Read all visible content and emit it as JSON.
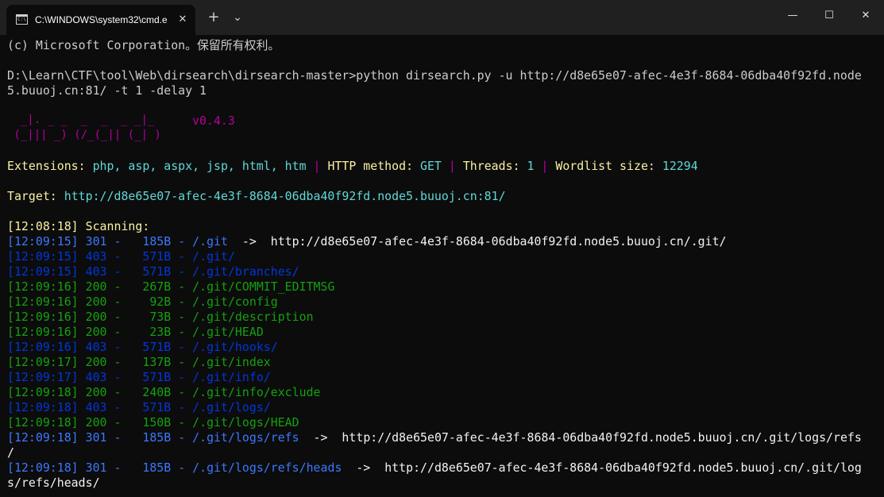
{
  "window": {
    "tab_title": "C:\\WINDOWS\\system32\\cmd.e",
    "tab_close": "✕",
    "new_tab": "+",
    "dropdown": "⌄",
    "minimize": "—",
    "maximize": "☐",
    "close": "✕"
  },
  "terminal": {
    "copyright": "(c) Microsoft Corporation。保留所有权利。",
    "command_line1": "D:\\Learn\\CTF\\tool\\Web\\dirsearch\\dirsearch-master>python dirsearch.py -u http://d8e65e07-afec-4e3f-8684-06dba40f92fd.node",
    "command_line2": "5.buuoj.cn:81/ -t 1 -delay 1",
    "logo_line1": "  _|. _ _  _  _  _ _|_",
    "logo_line2": " (_||| _) (/_(_|| (_| )",
    "version": "v0.4.3",
    "ext_label": "Extensions: ",
    "ext_value": "php, asp, aspx, jsp, html, htm",
    "sep": " | ",
    "method_label": "HTTP method: ",
    "method_value": "GET",
    "threads_label": "Threads: ",
    "threads_value": "1",
    "wordlist_label": "Wordlist size: ",
    "wordlist_value": "12294",
    "target_label": "Target: ",
    "target_value": "http://d8e65e07-afec-4e3f-8684-06dba40f92fd.node5.buuoj.cn:81/",
    "scanning": "[12:08:18] Scanning:",
    "results": [
      {
        "time": "[12:09:15]",
        "status": "301",
        "size": "185B",
        "path": "/.git",
        "redirect": "http://d8e65e07-afec-4e3f-8684-06dba40f92fd.node5.buuoj.cn/.git/",
        "color": "blue"
      },
      {
        "time": "[12:09:15]",
        "status": "403",
        "size": "571B",
        "path": "/.git/",
        "color": "dblue"
      },
      {
        "time": "[12:09:15]",
        "status": "403",
        "size": "571B",
        "path": "/.git/branches/",
        "color": "dblue"
      },
      {
        "time": "[12:09:16]",
        "status": "200",
        "size": "267B",
        "path": "/.git/COMMIT_EDITMSG",
        "color": "green"
      },
      {
        "time": "[12:09:16]",
        "status": "200",
        "size": "92B",
        "path": "/.git/config",
        "color": "green"
      },
      {
        "time": "[12:09:16]",
        "status": "200",
        "size": "73B",
        "path": "/.git/description",
        "color": "green"
      },
      {
        "time": "[12:09:16]",
        "status": "200",
        "size": "23B",
        "path": "/.git/HEAD",
        "color": "green"
      },
      {
        "time": "[12:09:16]",
        "status": "403",
        "size": "571B",
        "path": "/.git/hooks/",
        "color": "dblue"
      },
      {
        "time": "[12:09:17]",
        "status": "200",
        "size": "137B",
        "path": "/.git/index",
        "color": "green"
      },
      {
        "time": "[12:09:17]",
        "status": "403",
        "size": "571B",
        "path": "/.git/info/",
        "color": "dblue"
      },
      {
        "time": "[12:09:18]",
        "status": "200",
        "size": "240B",
        "path": "/.git/info/exclude",
        "color": "green"
      },
      {
        "time": "[12:09:18]",
        "status": "403",
        "size": "571B",
        "path": "/.git/logs/",
        "color": "dblue"
      },
      {
        "time": "[12:09:18]",
        "status": "200",
        "size": "150B",
        "path": "/.git/logs/HEAD",
        "color": "green"
      },
      {
        "time": "[12:09:18]",
        "status": "301",
        "size": "185B",
        "path": "/.git/logs/refs",
        "redirect": "http://d8e65e07-afec-4e3f-8684-06dba40f92fd.node5.buuoj.cn/.git/logs/refs",
        "redirect_cont": "/",
        "color": "blue"
      },
      {
        "time": "[12:09:18]",
        "status": "301",
        "size": "185B",
        "path": "/.git/logs/refs/heads",
        "redirect": "http://d8e65e07-afec-4e3f-8684-06dba40f92fd.node5.buuoj.cn/.git/log",
        "redirect_cont": "s/refs/heads/",
        "color": "blue"
      }
    ]
  }
}
